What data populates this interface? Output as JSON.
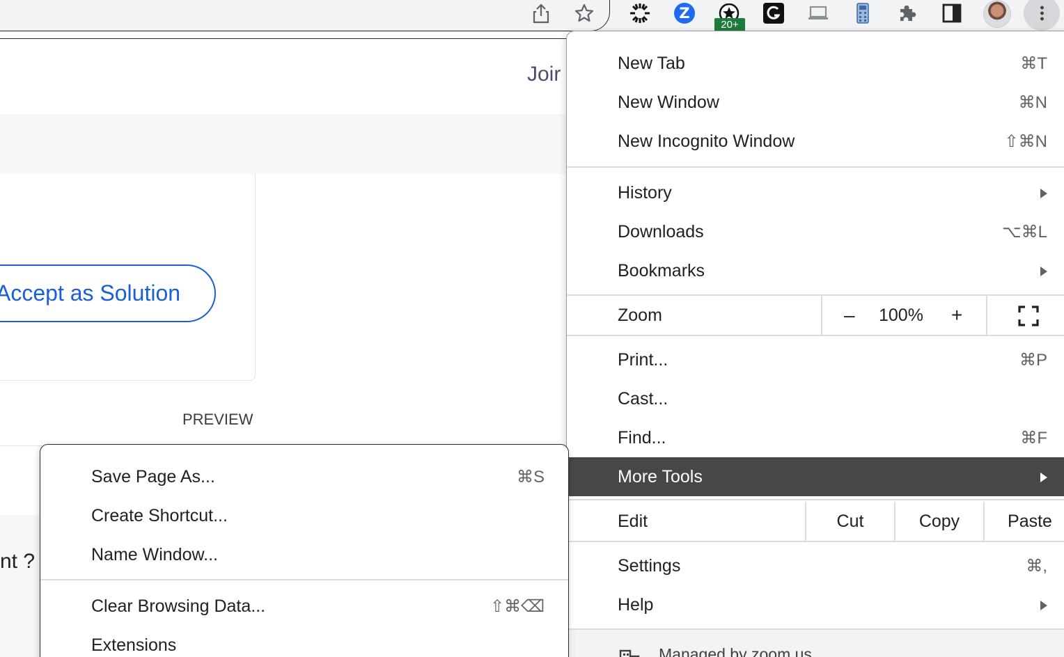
{
  "browser": {
    "extension_badge": "20+",
    "icons": [
      "share-icon",
      "bookmark-star-icon",
      "sunburst-extension-icon",
      "zoom-extension-icon",
      "badge-star-extension-icon",
      "grammarly-extension-icon",
      "laptop-icon",
      "calculator-icon",
      "extensions-puzzle-icon",
      "side-panel-icon",
      "profile-avatar",
      "more-vert-icon"
    ]
  },
  "page": {
    "join_text": "Joir",
    "accept_button": "Accept as Solution",
    "preview_label": "PREVIEW",
    "partial_text": "nt ?"
  },
  "main_menu": {
    "new_tab": {
      "label": "New Tab",
      "shortcut": "⌘T"
    },
    "new_window": {
      "label": "New Window",
      "shortcut": "⌘N"
    },
    "new_incognito": {
      "label": "New Incognito Window",
      "shortcut": "⇧⌘N"
    },
    "history": {
      "label": "History"
    },
    "downloads": {
      "label": "Downloads",
      "shortcut": "⌥⌘L"
    },
    "bookmarks": {
      "label": "Bookmarks"
    },
    "zoom": {
      "label": "Zoom",
      "minus": "–",
      "value": "100%",
      "plus": "+"
    },
    "print": {
      "label": "Print...",
      "shortcut": "⌘P"
    },
    "cast": {
      "label": "Cast..."
    },
    "find": {
      "label": "Find...",
      "shortcut": "⌘F"
    },
    "more_tools": {
      "label": "More Tools"
    },
    "edit": {
      "label": "Edit",
      "cut": "Cut",
      "copy": "Copy",
      "paste": "Paste"
    },
    "settings": {
      "label": "Settings",
      "shortcut": "⌘,"
    },
    "help": {
      "label": "Help"
    },
    "managed": {
      "label": "Managed by zoom.us"
    }
  },
  "sub_menu": {
    "save_page": {
      "label": "Save Page As...",
      "shortcut": "⌘S"
    },
    "create_shortcut": {
      "label": "Create Shortcut..."
    },
    "name_window": {
      "label": "Name Window..."
    },
    "clear_browsing": {
      "label": "Clear Browsing Data...",
      "shortcut": "⇧⌘⌫"
    },
    "extensions": {
      "label": "Extensions"
    }
  },
  "colors": {
    "accent": "#1a5fd6",
    "menu_active_bg": "#474747",
    "toolbar_bg": "#f1f3f4"
  }
}
